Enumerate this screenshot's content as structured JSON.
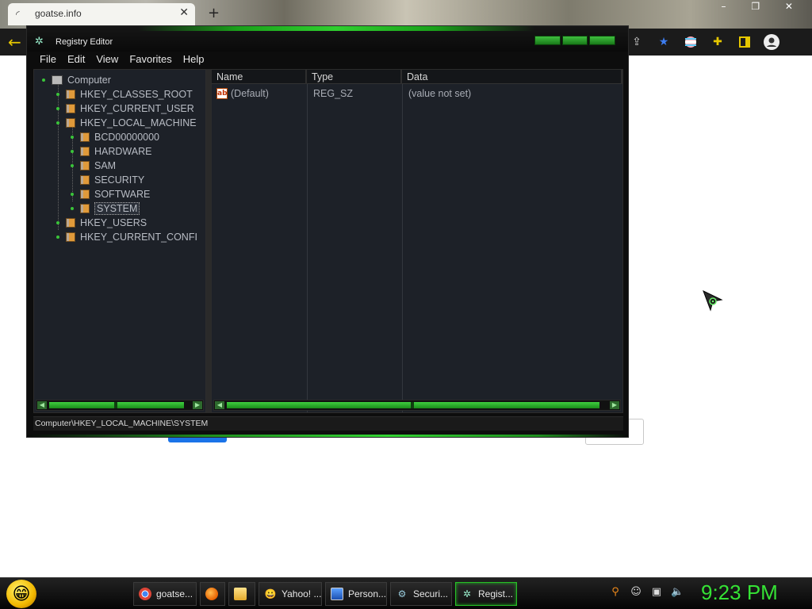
{
  "browser": {
    "tab_title": "goatse.info",
    "tab_close": "✕",
    "new_tab": "+",
    "window_controls": "– ❐ ✕",
    "back": "←"
  },
  "regedit": {
    "title": "Registry Editor",
    "menu": [
      "File",
      "Edit",
      "View",
      "Favorites",
      "Help"
    ],
    "tree": {
      "root": "Computer",
      "hives": [
        "HKEY_CLASSES_ROOT",
        "HKEY_CURRENT_USER",
        "HKEY_LOCAL_MACHINE",
        "BCD00000000",
        "HARDWARE",
        "SAM",
        "SECURITY",
        "SOFTWARE",
        "SYSTEM",
        "HKEY_USERS",
        "HKEY_CURRENT_CONFI"
      ],
      "selected": "SYSTEM"
    },
    "columns": {
      "name": "Name",
      "type": "Type",
      "data": "Data"
    },
    "values": [
      {
        "icon": "ab",
        "name": "(Default)",
        "type": "REG_SZ",
        "data": "(value not set)"
      }
    ],
    "status_path": "Computer\\HKEY_LOCAL_MACHINE\\SYSTEM"
  },
  "taskbar": {
    "items": [
      {
        "label": "goatse...",
        "icon": "chrome-icon",
        "active": false
      },
      {
        "label": "",
        "icon": "firefox-icon",
        "active": false
      },
      {
        "label": "",
        "icon": "folder-icon",
        "active": false
      },
      {
        "label": "Yahoo! ...",
        "icon": "yahoo-smiley-icon",
        "active": false
      },
      {
        "label": "Person...",
        "icon": "monitor-icon",
        "active": false
      },
      {
        "label": "Securi...",
        "icon": "security-icon",
        "active": false
      },
      {
        "label": "Regist...",
        "icon": "regedit-icon",
        "active": true
      }
    ],
    "clock": "9:23 PM"
  },
  "colors": {
    "accent_green": "#35e235",
    "window_bg": "#0d0d0d",
    "pane_bg": "#1d2128"
  }
}
